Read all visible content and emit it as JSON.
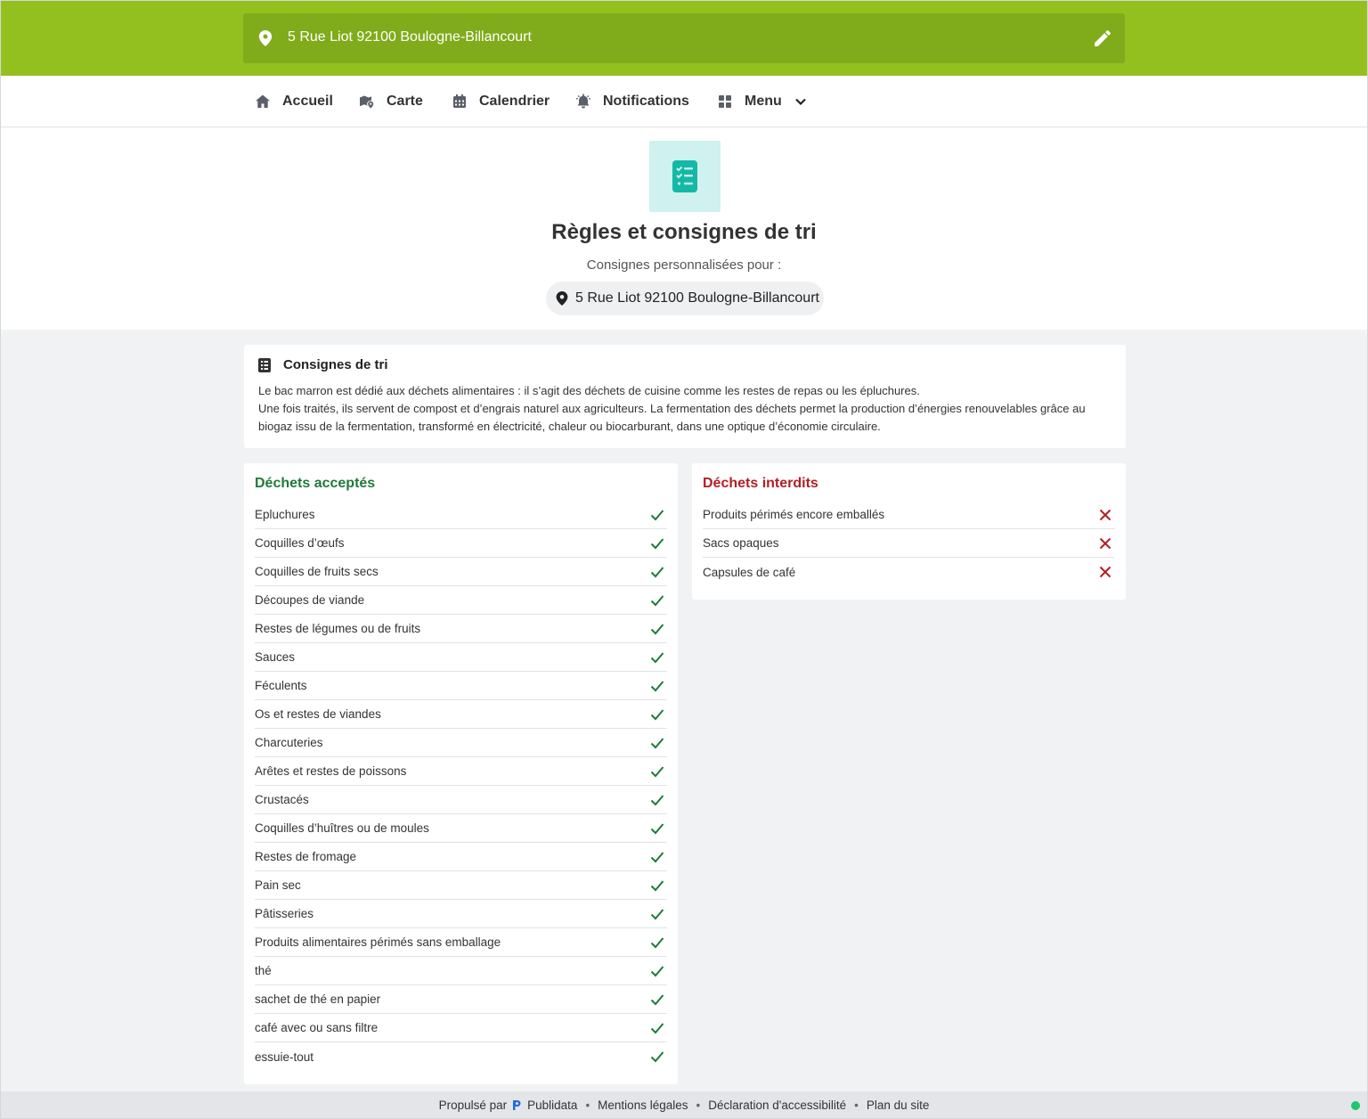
{
  "topbar": {
    "address": "5 Rue Liot 92100 Boulogne-Billancourt"
  },
  "nav": {
    "items": [
      {
        "label": "Accueil",
        "icon": "home-icon"
      },
      {
        "label": "Carte",
        "icon": "map-icon"
      },
      {
        "label": "Calendrier",
        "icon": "calendar-icon"
      },
      {
        "label": "Notifications",
        "icon": "bell-icon"
      },
      {
        "label": "Menu",
        "icon": "grid-icon"
      }
    ]
  },
  "header": {
    "title": "Règles et consignes de tri",
    "subtitle": "Consignes personnalisées pour :",
    "address": "5 Rue Liot 92100 Boulogne-Billancourt"
  },
  "consignes": {
    "title": "Consignes de tri",
    "line1": "Le bac marron est dédié aux déchets alimentaires : il s’agit des déchets de cuisine comme les restes de repas ou les épluchures.",
    "line2": "Une fois traités, ils servent de compost et d’engrais naturel aux agriculteurs. La fermentation des déchets permet la production d’énergies renouvelables grâce au biogaz issu de la fermentation, transformé en électricité, chaleur ou biocarburant, dans une optique d’économie circulaire."
  },
  "accepted": {
    "title": "Déchets acceptés",
    "items": [
      "Epluchures",
      "Coquilles d’œufs",
      "Coquilles de fruits secs",
      "Découpes de viande",
      "Restes de légumes ou de fruits",
      "Sauces",
      "Féculents",
      "Os et restes de viandes",
      "Charcuteries",
      "Arêtes et restes de poissons",
      "Crustacés",
      "Coquilles d’huîtres ou de moules",
      "Restes de fromage",
      "Pain sec",
      "Pâtisseries",
      "Produits alimentaires périmés sans emballage",
      "thé",
      "sachet de thé en papier",
      "café avec ou sans filtre",
      "essuie-tout"
    ]
  },
  "forbidden": {
    "title": "Déchets interdits",
    "items": [
      "Produits périmés encore emballés",
      "Sacs opaques",
      "Capsules de café"
    ]
  },
  "footer": {
    "powered_by": "Propulsé par",
    "brand": "Publidata",
    "links": [
      "Mentions légales",
      "Déclaration d'accessibilité",
      "Plan du site"
    ]
  },
  "colors": {
    "brand_green": "#93c01f",
    "accepted_green": "#1f7a3a",
    "forbidden_red": "#b31e24",
    "teal_icon": "#14b8a6"
  }
}
